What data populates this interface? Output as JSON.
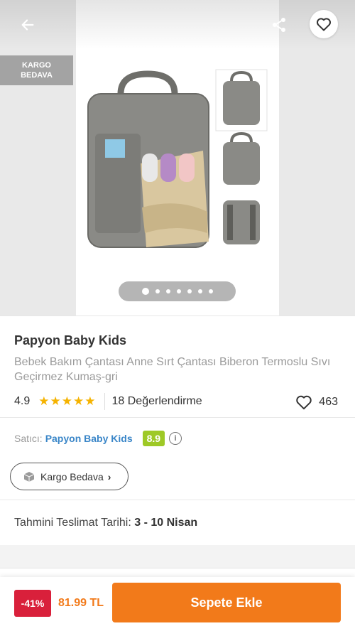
{
  "hero": {
    "badge": {
      "line1": "KARGO",
      "line2": "BEDAVA"
    },
    "icons": {
      "back": "arrow-left-icon",
      "share": "share-icon",
      "favorite": "heart-outline-icon"
    },
    "gallery": {
      "total": 7,
      "active_index": 0
    }
  },
  "product": {
    "brand": "Papyon Baby Kids",
    "title": "Bebek Bakım Çantası Anne Sırt Çantası Biberon Termoslu Sıvı Geçirmez Kumaş-gri",
    "rating": "4.9",
    "stars": 5,
    "reviews": "18 Değerlendirme",
    "favorites": "463"
  },
  "seller": {
    "label": "Satıcı:",
    "name": "Papyon Baby Kids",
    "score": "8.9"
  },
  "shipping": {
    "pill_label": "Kargo Bedava",
    "delivery_label": "Tahmini Teslimat Tarihi:",
    "delivery_value": "3 - 10 Nisan"
  },
  "bottom": {
    "discount": "-41%",
    "price": "81.99 TL",
    "cart_button": "Sepete Ekle"
  },
  "colors": {
    "accent": "#f27a1a",
    "discount": "#d9203b",
    "seller_link": "#3a86c8",
    "seller_score": "#9ec926",
    "star": "#f5b301"
  }
}
